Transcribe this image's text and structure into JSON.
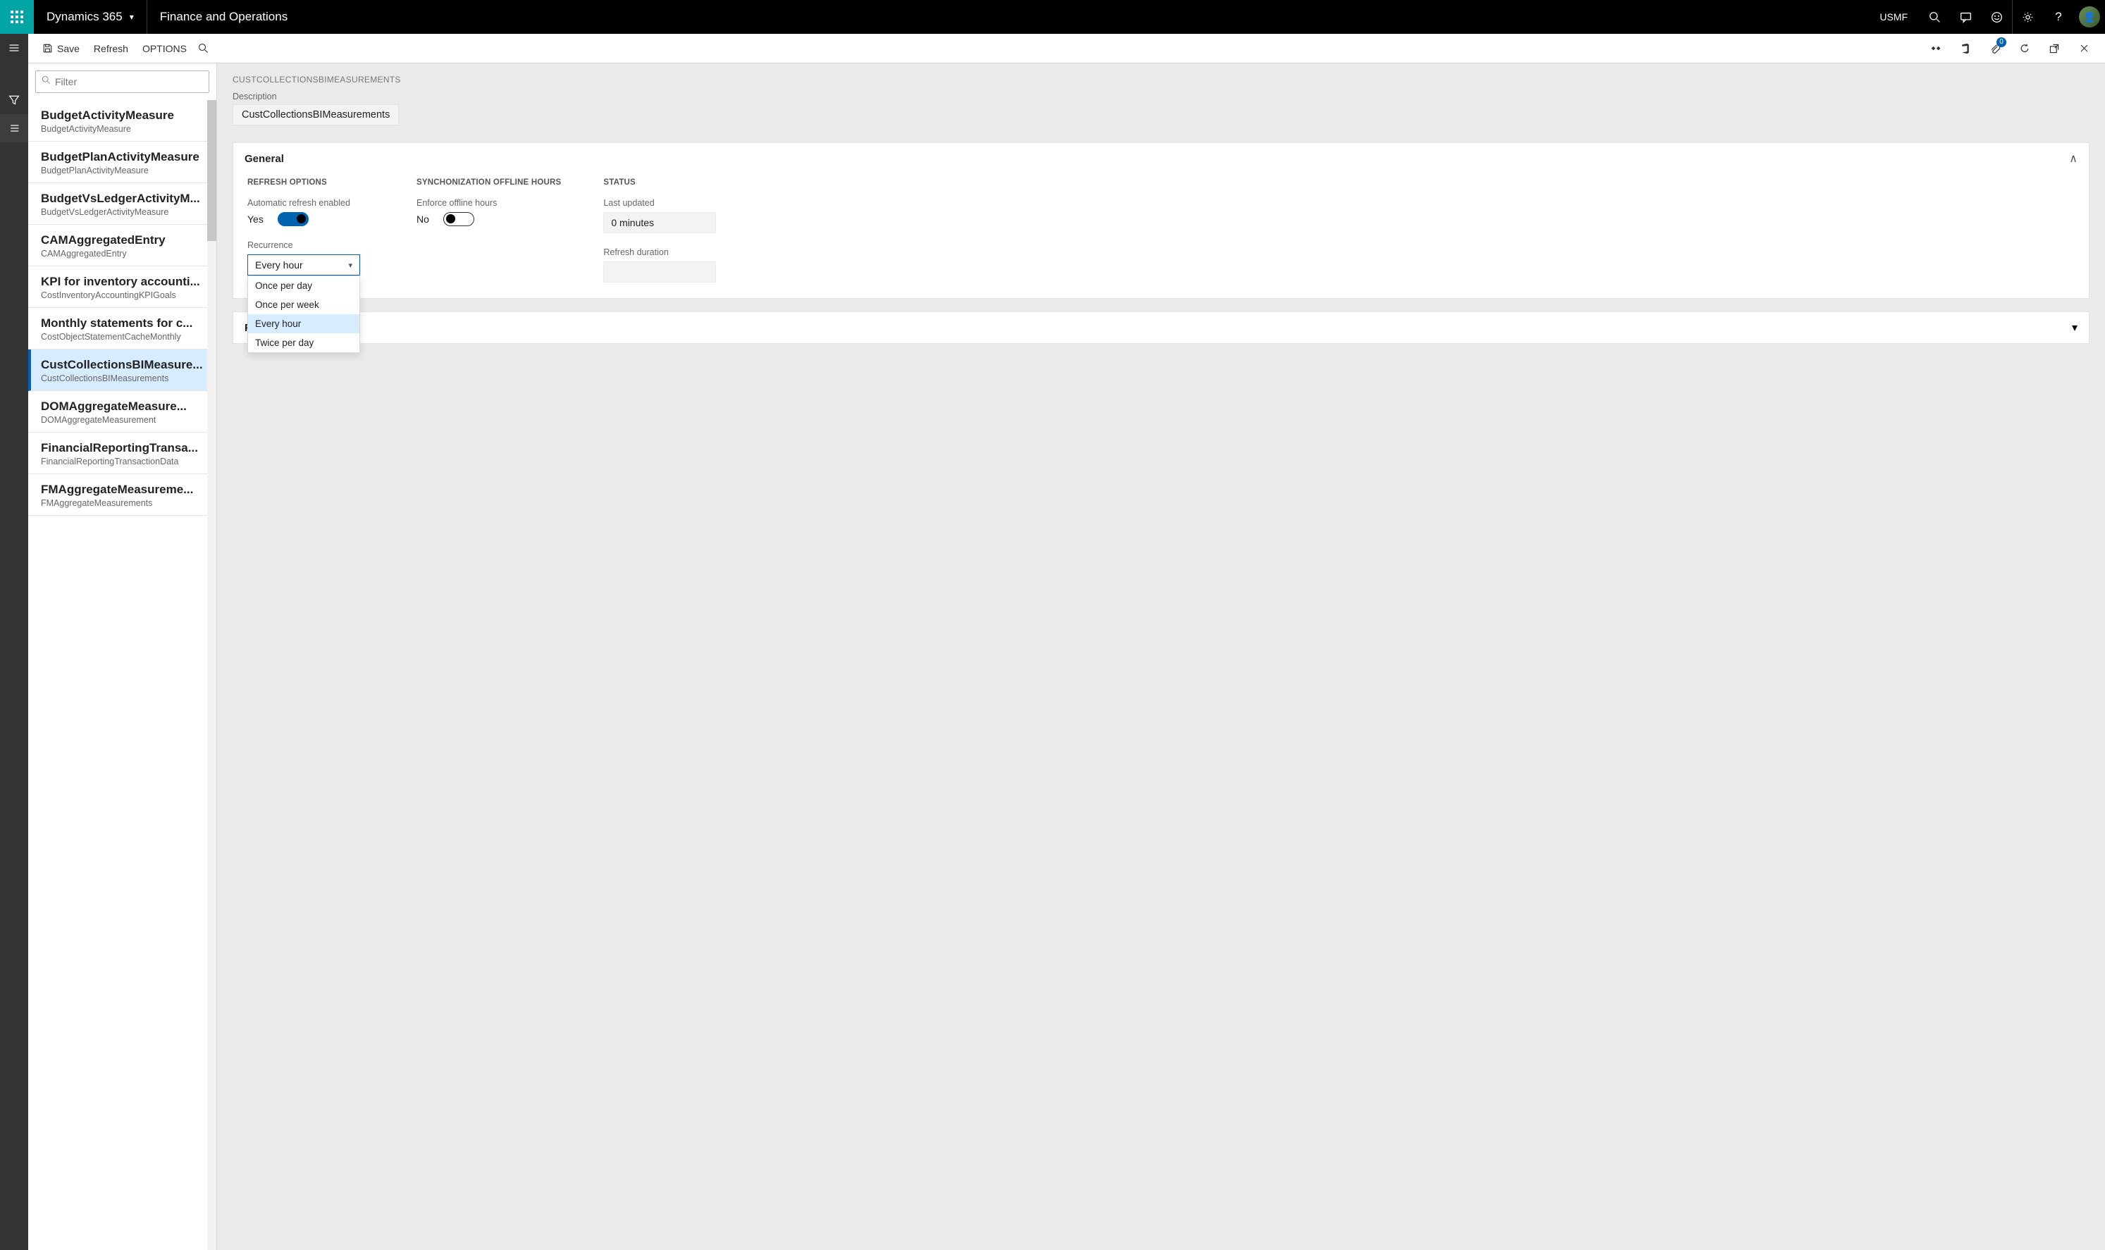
{
  "topbar": {
    "brand": "Dynamics 365",
    "app_title": "Finance and Operations",
    "company": "USMF"
  },
  "actionbar": {
    "save": "Save",
    "refresh": "Refresh",
    "options": "OPTIONS",
    "badge": "0"
  },
  "list": {
    "filter_placeholder": "Filter",
    "items": [
      {
        "title": "BudgetActivityMeasure",
        "sub": "BudgetActivityMeasure"
      },
      {
        "title": "BudgetPlanActivityMeasure",
        "sub": "BudgetPlanActivityMeasure"
      },
      {
        "title": "BudgetVsLedgerActivityM...",
        "sub": "BudgetVsLedgerActivityMeasure"
      },
      {
        "title": "CAMAggregatedEntry",
        "sub": "CAMAggregatedEntry"
      },
      {
        "title": "KPI for inventory accounti...",
        "sub": "CostInventoryAccountingKPIGoals"
      },
      {
        "title": "Monthly statements for c...",
        "sub": "CostObjectStatementCacheMonthly"
      },
      {
        "title": "CustCollectionsBIMeasure...",
        "sub": "CustCollectionsBIMeasurements"
      },
      {
        "title": "DOMAggregateMeasure...",
        "sub": "DOMAggregateMeasurement"
      },
      {
        "title": "FinancialReportingTransa...",
        "sub": "FinancialReportingTransactionData"
      },
      {
        "title": "FMAggregateMeasureme...",
        "sub": "FMAggregateMeasurements"
      }
    ],
    "selected_index": 6
  },
  "content": {
    "crumb": "CUSTCOLLECTIONSBIMEASUREMENTS",
    "description_label": "Description",
    "description_value": "CustCollectionsBIMeasurements",
    "general": {
      "title": "General",
      "refresh_options_heading": "REFRESH OPTIONS",
      "auto_refresh_label": "Automatic refresh enabled",
      "auto_refresh_value": "Yes",
      "recurrence_label": "Recurrence",
      "recurrence_value": "Every hour",
      "recurrence_options": [
        "Once per day",
        "Once per week",
        "Every hour",
        "Twice per day"
      ],
      "offline_heading": "SYNCHONIZATION OFFLINE HOURS",
      "enforce_offline_label": "Enforce offline hours",
      "enforce_offline_value": "No",
      "status_heading": "STATUS",
      "last_updated_label": "Last updated",
      "last_updated_value": "0 minutes",
      "refresh_duration_label": "Refresh duration",
      "refresh_duration_value": ""
    },
    "second_section": {
      "title_visible": "R"
    }
  }
}
